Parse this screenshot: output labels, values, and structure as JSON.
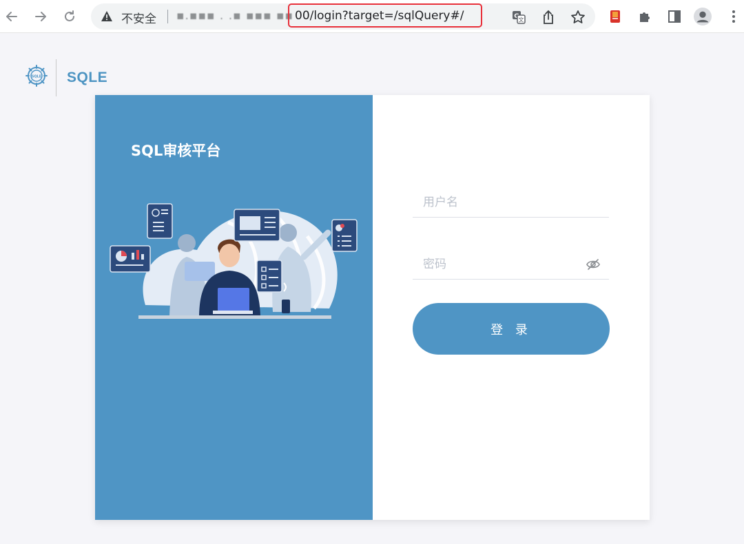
{
  "browser": {
    "security_label": "不安全",
    "host_masked": "▪.▪▪▪ . .▪ ▪▪▪ ▪▪",
    "url_path": "00/login?target=/sqlQuery#/",
    "icons": [
      "back-icon",
      "forward-icon",
      "reload-icon",
      "warning-icon",
      "translate-icon",
      "share-icon",
      "star-icon",
      "extension-red-icon",
      "puzzle-icon",
      "sidepanel-icon",
      "profile-icon",
      "menu-icon"
    ],
    "highlight_color": "#e8303a"
  },
  "header": {
    "brand": "SQLE",
    "logo_text": "SQLE"
  },
  "panel": {
    "title": "SQL审核平台",
    "color": "#4f95c5"
  },
  "form": {
    "username_placeholder": "用户名",
    "password_placeholder": "密码",
    "submit_label": "登 录"
  },
  "colors": {
    "accent": "#4f95c5",
    "background": "#f5f5f9"
  }
}
